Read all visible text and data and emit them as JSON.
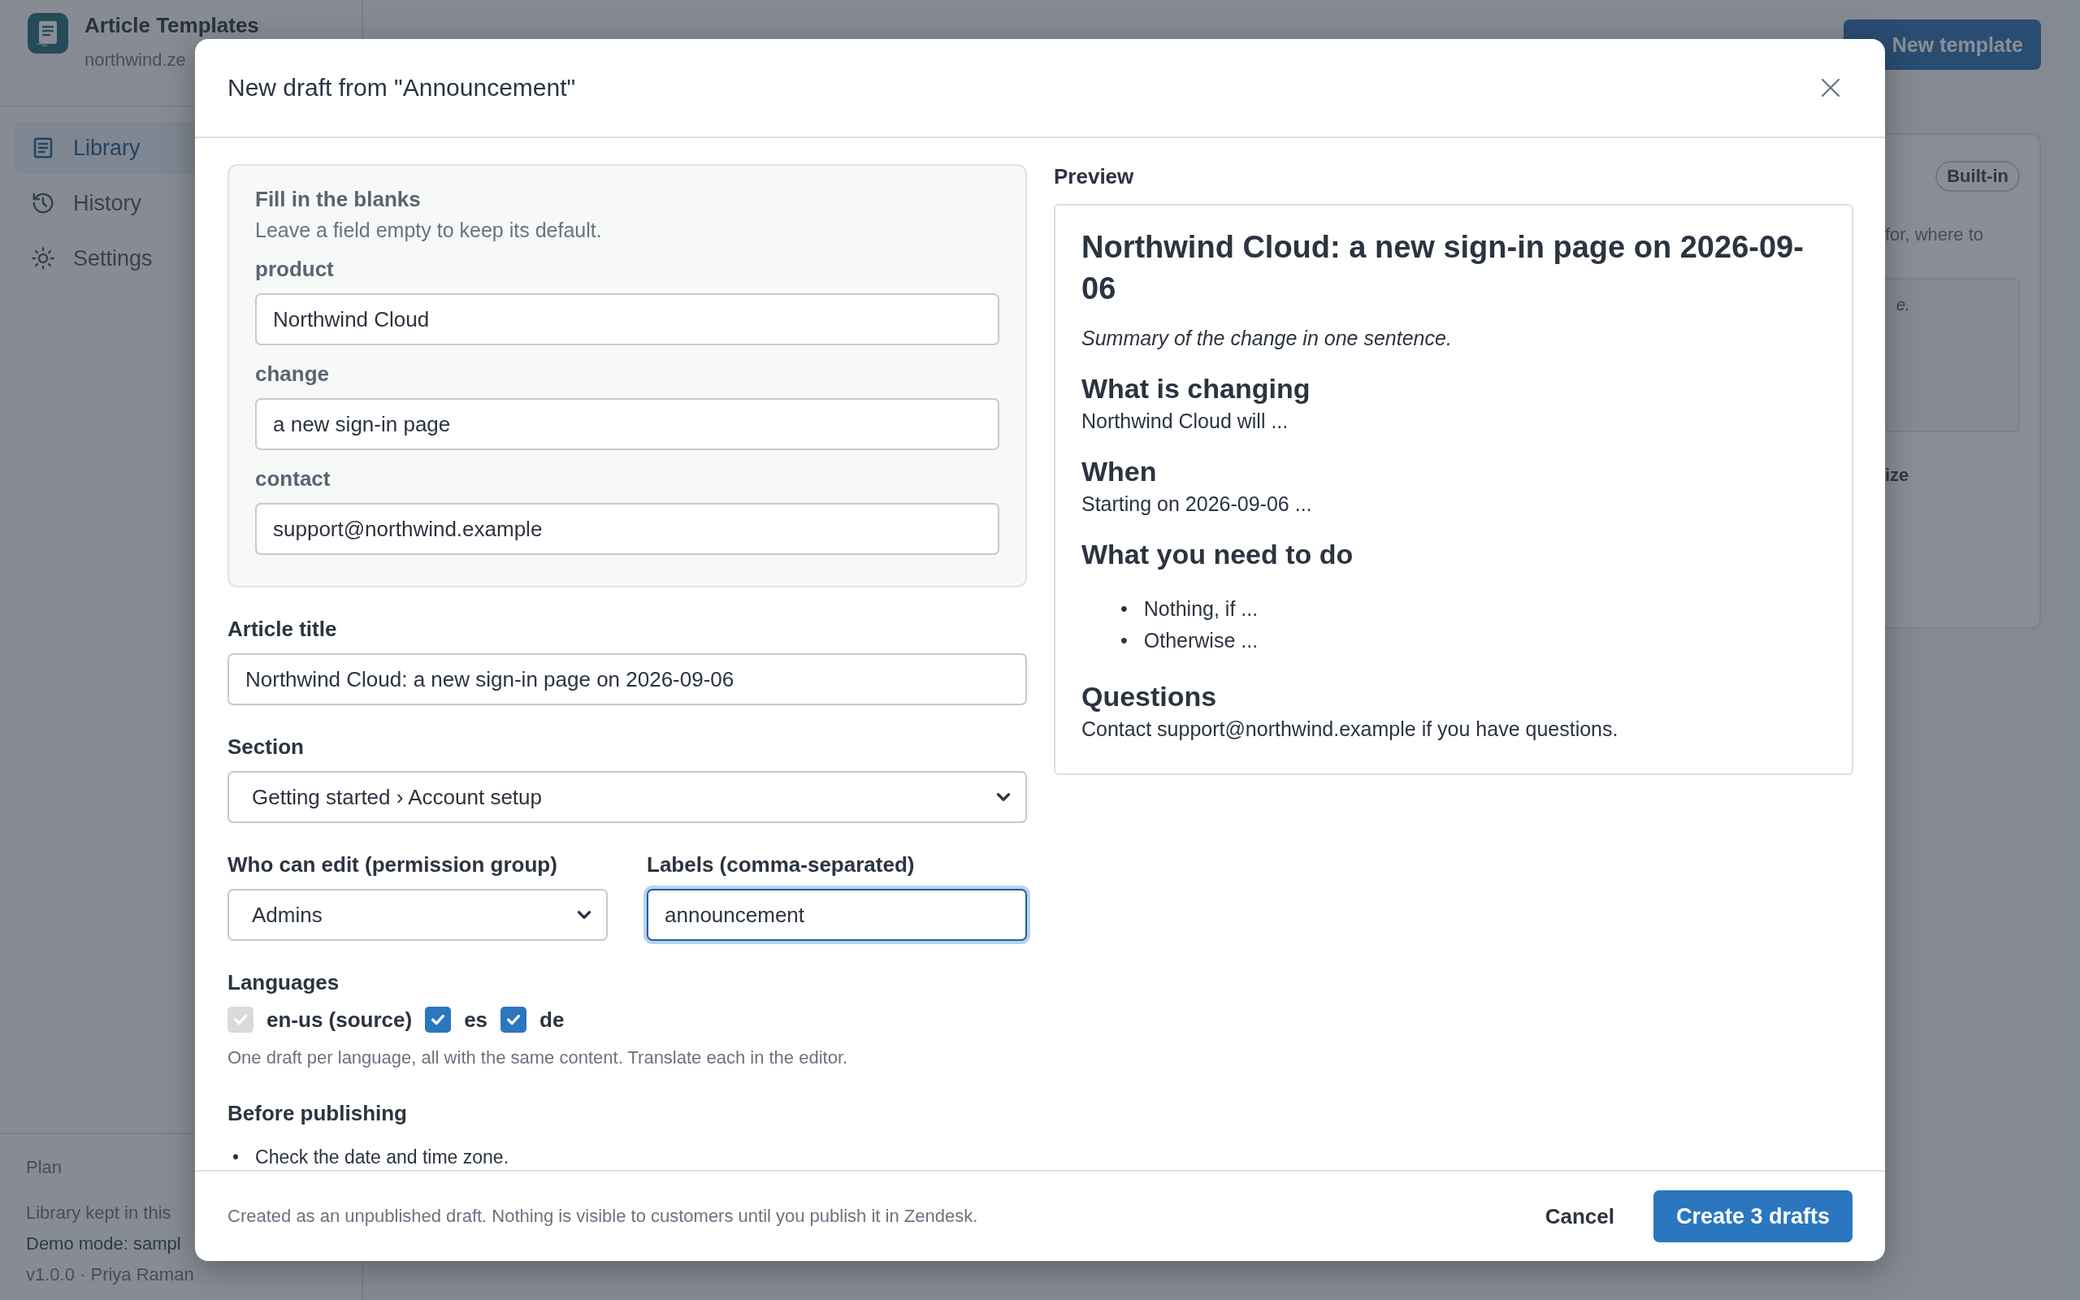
{
  "sidebar": {
    "app_title": "Article Templates",
    "app_subtitle": "northwind.ze",
    "nav": [
      {
        "label": "Library",
        "selected": true
      },
      {
        "label": "History",
        "selected": false
      },
      {
        "label": "Settings",
        "selected": false
      }
    ],
    "footer": {
      "plan": "Plan",
      "storage_note": "Library kept in this",
      "demo_note": "Demo mode: sampl",
      "version": "v1.0.0 · Priya Raman"
    }
  },
  "header": {
    "primary_button": "New template"
  },
  "card": {
    "badge": "Built-in",
    "text_1": "for, where to",
    "text_2": "e.",
    "text_3": "ize"
  },
  "dialog": {
    "title": "New draft from \"Announcement\"",
    "blanks": {
      "heading": "Fill in the blanks",
      "hint": "Leave a field empty to keep its default.",
      "fields": [
        {
          "label": "product",
          "value": "Northwind Cloud"
        },
        {
          "label": "change",
          "value": "a new sign-in page"
        },
        {
          "label": "contact",
          "value": "support@northwind.example"
        }
      ]
    },
    "article_title": {
      "label": "Article title",
      "value": "Northwind Cloud: a new sign-in page on 2026-09-06"
    },
    "section": {
      "label": "Section",
      "value": "Getting started › Account setup"
    },
    "permission": {
      "label": "Who can edit (permission group)",
      "value": "Admins"
    },
    "labels": {
      "label": "Labels (comma-separated)",
      "value": "announcement",
      "focused": true
    },
    "languages": {
      "label": "Languages",
      "hint": "One draft per language, all with the same content. Translate each in the editor.",
      "options": [
        {
          "label": "en-us (source)",
          "checked": true,
          "disabled": true
        },
        {
          "label": "es",
          "checked": true,
          "disabled": false
        },
        {
          "label": "de",
          "checked": true,
          "disabled": false
        }
      ]
    },
    "checklist": {
      "heading": "Before publishing",
      "items": [
        {
          "marker": "•",
          "text": "Check the date and time zone."
        }
      ]
    },
    "preview": {
      "label": "Preview",
      "title": "Northwind Cloud: a new sign-in page on 2026-09-06",
      "summary": "Summary of the change in one sentence.",
      "sections": [
        {
          "heading": "What is changing",
          "body": "Northwind Cloud will ..."
        },
        {
          "heading": "When",
          "body": "Starting on 2026-09-06 ..."
        },
        {
          "heading": "What you need to do",
          "bullets": [
            {
              "marker": "•",
              "text": "Nothing, if ..."
            },
            {
              "marker": "•",
              "text": "Otherwise ..."
            }
          ]
        },
        {
          "heading": "Questions",
          "body": "Contact support@northwind.example if you have questions."
        }
      ]
    },
    "footer": {
      "note": "Created as an unpublished draft. Nothing is visible to customers until you publish it in Zendesk.",
      "cancel": "Cancel",
      "submit": "Create 3 drafts"
    }
  }
}
